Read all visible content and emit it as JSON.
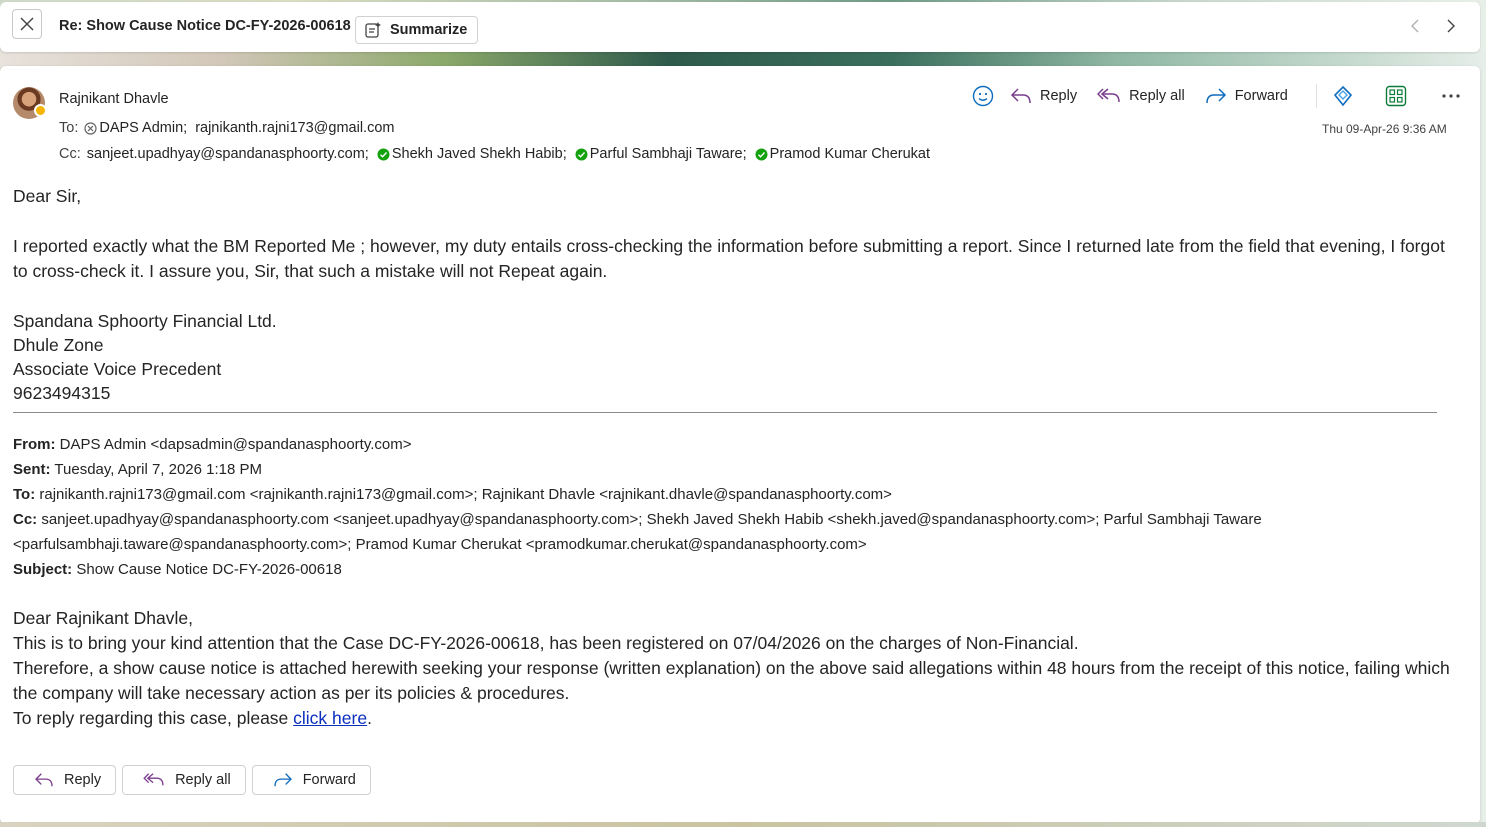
{
  "header": {
    "subject": "Re: Show Cause Notice DC-FY-2026-00618",
    "summarize_label": "Summarize"
  },
  "message": {
    "sender": "Rajnikant Dhavle",
    "to_label": "To:",
    "to": [
      "DAPS Admin;",
      "rajnikanth.rajni173@gmail.com"
    ],
    "cc_label": "Cc:",
    "cc": [
      "sanjeet.upadhyay@spandanasphoorty.com;",
      "Shekh Javed Shekh Habib;",
      "Parful Sambhaji Taware;",
      "Pramod Kumar Cherukat"
    ],
    "timestamp": "Thu 09-Apr-26 9:36 AM"
  },
  "actions": {
    "reply": "Reply",
    "reply_all": "Reply all",
    "forward": "Forward"
  },
  "body": {
    "greeting": "Dear Sir,",
    "paragraph": "I reported exactly what the BM Reported Me ; however, my duty entails cross-checking the information before submitting a report. Since I returned late from the field that evening, I forgot to cross-check it. I assure you, Sir, that such a mistake will not Repeat again.",
    "signature": [
      "Spandana Sphoorty Financial Ltd.",
      "Dhule Zone",
      "Associate Voice Precedent",
      "9623494315"
    ]
  },
  "forwarded": {
    "from_label": "From:",
    "from": "DAPS Admin <dapsadmin@spandanasphoorty.com>",
    "sent_label": "Sent:",
    "sent": "Tuesday, April 7, 2026 1:18 PM",
    "to_label": "To:",
    "to": "rajnikanth.rajni173@gmail.com <rajnikanth.rajni173@gmail.com>; Rajnikant Dhavle <rajnikant.dhavle@spandanasphoorty.com>",
    "cc_label": "Cc:",
    "cc": "sanjeet.upadhyay@spandanasphoorty.com <sanjeet.upadhyay@spandanasphoorty.com>; Shekh Javed Shekh Habib <shekh.javed@spandanasphoorty.com>; Parful Sambhaji Taware <parfulsambhaji.taware@spandanasphoorty.com>; Pramod Kumar Cherukat <pramodkumar.cherukat@spandanasphoorty.com>",
    "subject_label": "Subject:",
    "subject": "Show Cause Notice DC-FY-2026-00618",
    "greeting": "Dear Rajnikant Dhavle,",
    "line1": "This is to bring your kind attention that the Case DC-FY-2026-00618, has been registered on 07/04/2026 on the charges of Non-Financial.",
    "line2": "Therefore, a show cause notice is attached herewith seeking your response (written explanation) on the above said allegations within 48 hours from the receipt of this notice, failing which the company will take necessary action as per its policies & procedures.",
    "line3_prefix": "To reply regarding this case, please ",
    "link_text": "click here",
    "line3_suffix": "."
  },
  "colors": {
    "accent": "#0f6cbd",
    "reply_all_icon": "#7a3e8e",
    "presence_away": "#f5b400",
    "verified": "#13a10e",
    "link": "#0b2fbf"
  },
  "icons": {
    "close": "close-icon",
    "summarize": "summarize-icon",
    "emoji": "emoji-icon",
    "reply": "reply-icon",
    "reply_all": "reply-all-icon",
    "forward": "forward-icon",
    "copilot": "copilot-icon",
    "apps": "apps-icon",
    "more": "more-icon"
  }
}
